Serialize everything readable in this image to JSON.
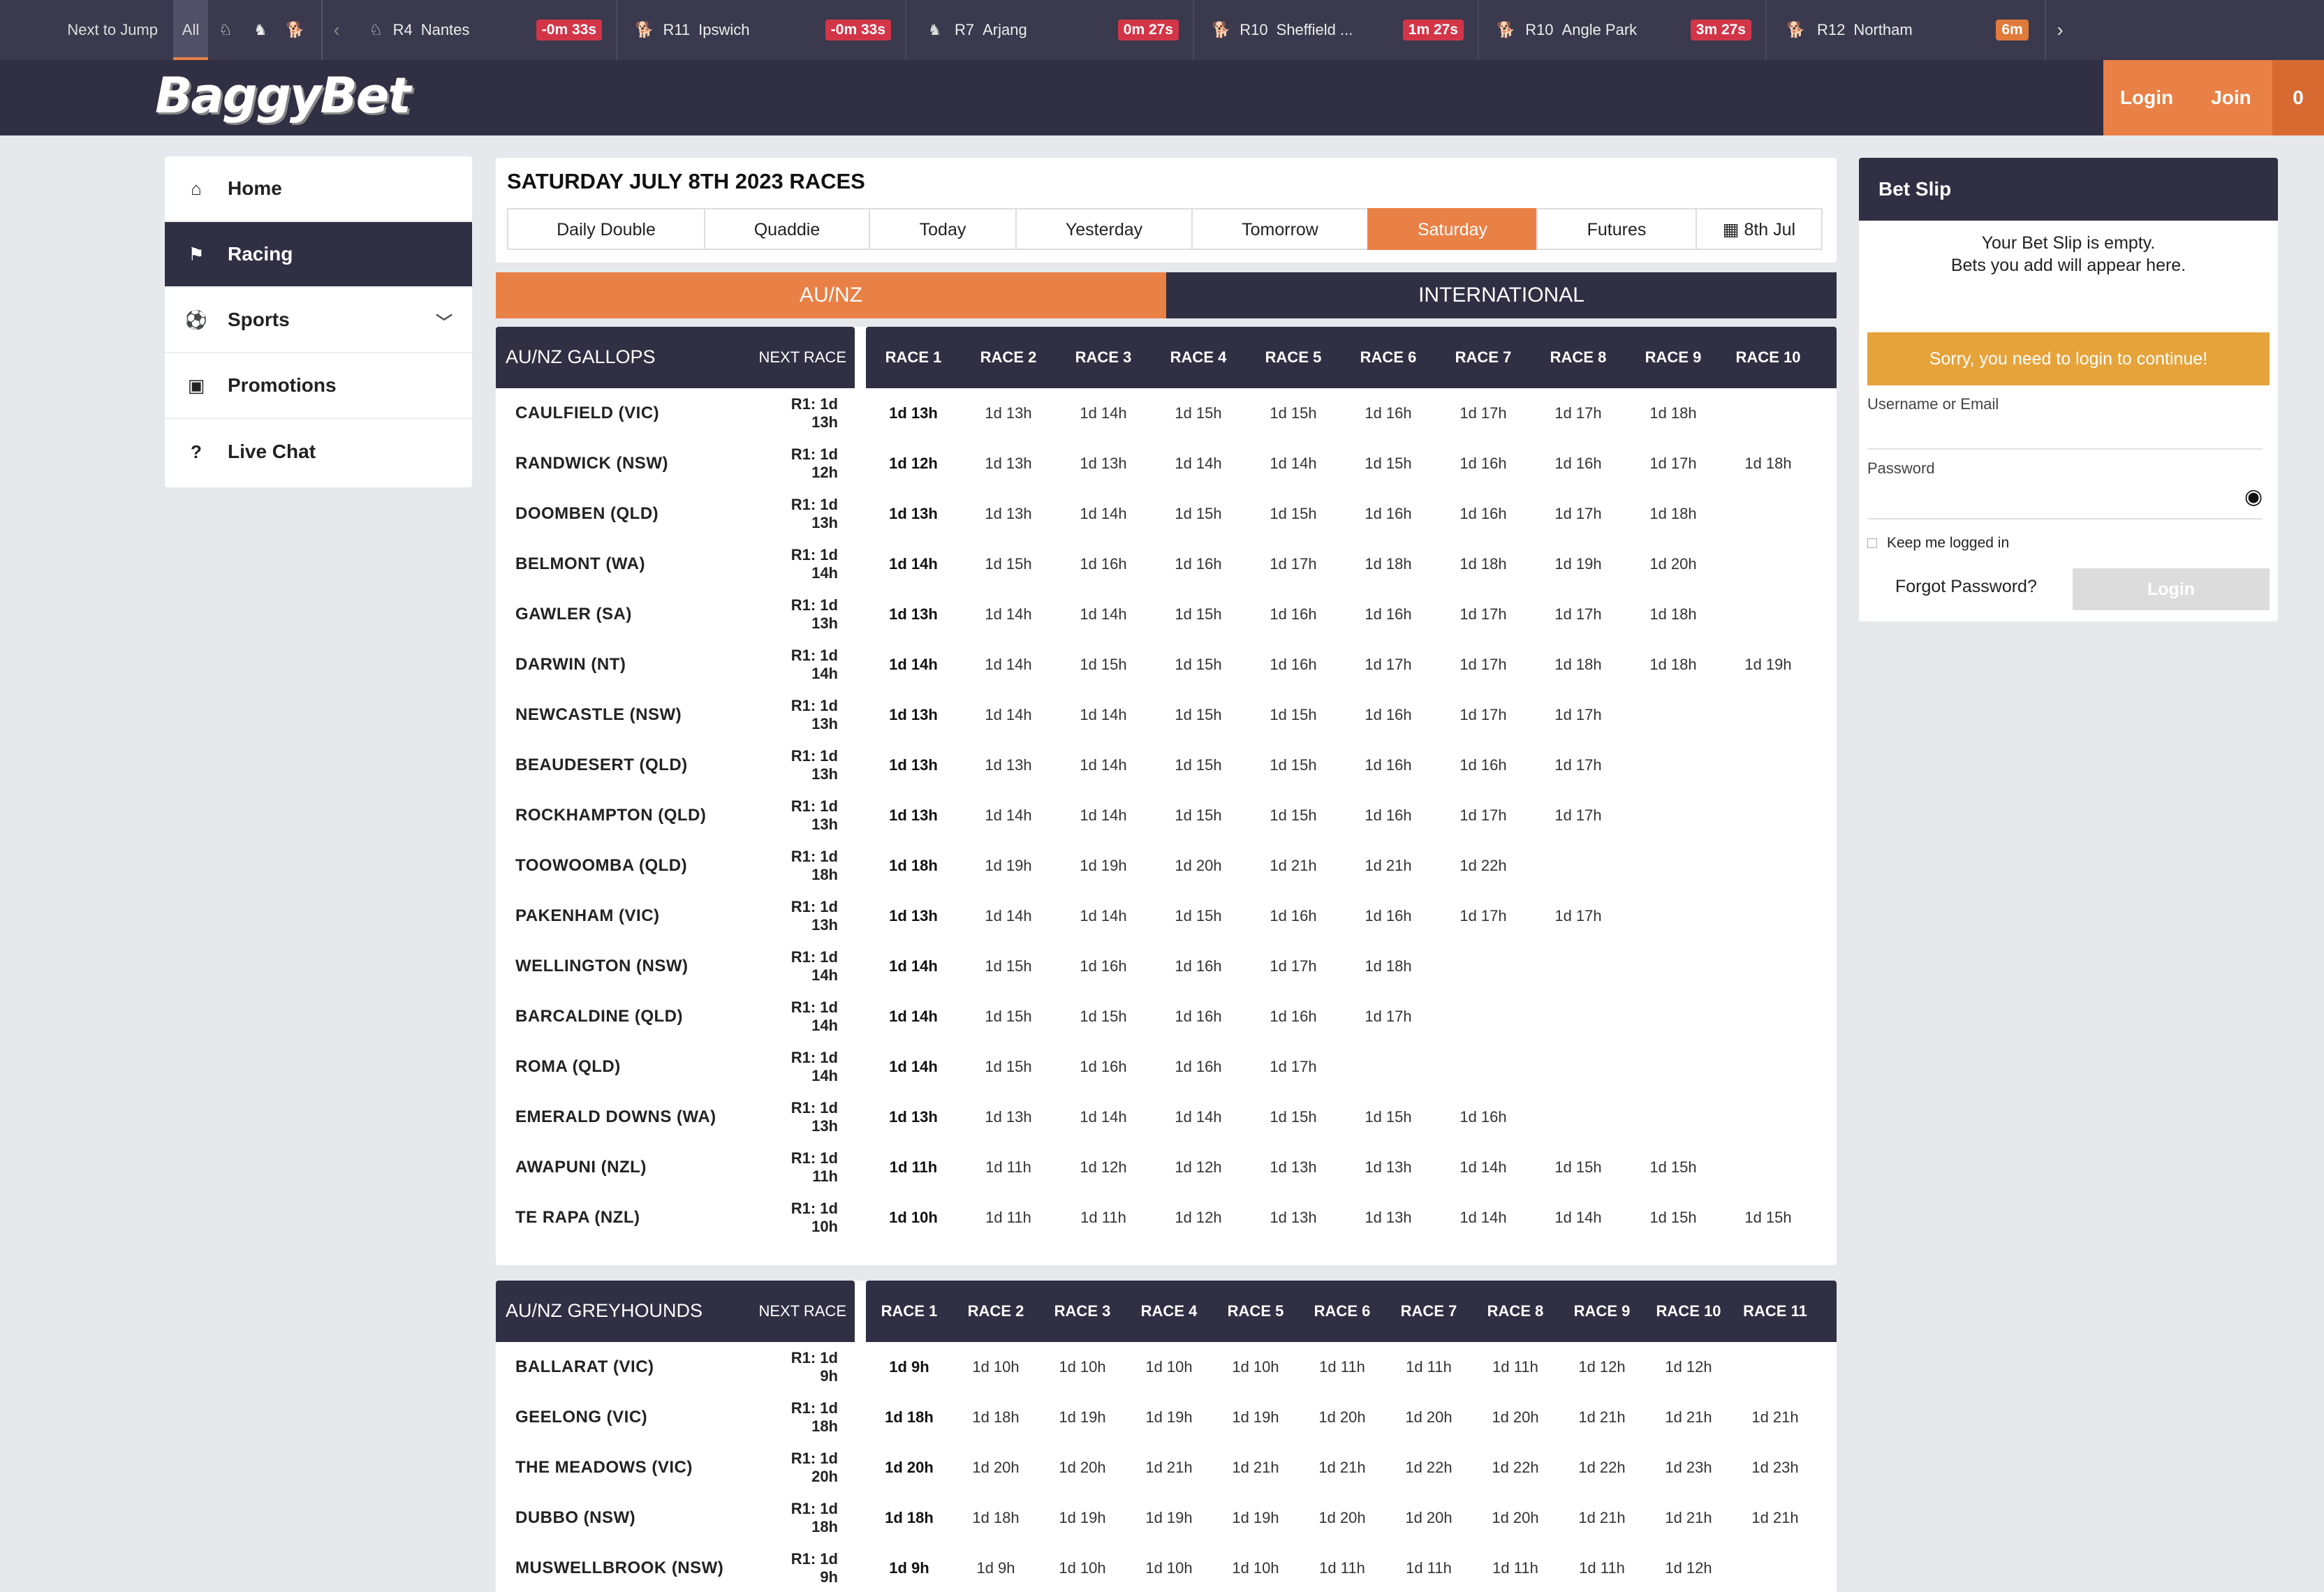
{
  "ticker": {
    "next_to_jump": "Next to Jump",
    "all": "All",
    "type_icons": [
      "horse-icon",
      "harness-icon",
      "greyhound-icon"
    ],
    "items": [
      {
        "race": "R4",
        "venue": "Nantes",
        "time": "-0m 33s",
        "icon": "horse-icon",
        "badge_color": "#d33548"
      },
      {
        "race": "R11",
        "venue": "Ipswich",
        "time": "-0m 33s",
        "icon": "greyhound-icon",
        "badge_color": "#d33548"
      },
      {
        "race": "R7",
        "venue": "Arjang",
        "time": "0m 27s",
        "icon": "harness-icon",
        "badge_color": "#d33548"
      },
      {
        "race": "R10",
        "venue": "Sheffield ...",
        "time": "1m 27s",
        "icon": "greyhound-icon",
        "badge_color": "#d33548"
      },
      {
        "race": "R10",
        "venue": "Angle Park",
        "time": "3m 27s",
        "icon": "greyhound-icon",
        "badge_color": "#d33548"
      },
      {
        "race": "R12",
        "venue": "Northam",
        "time": "6m",
        "icon": "greyhound-icon",
        "badge_color": "#e07a3a"
      }
    ]
  },
  "header": {
    "logo": "BaggyBet",
    "login": "Login",
    "join": "Join",
    "count": "0"
  },
  "sidebar": {
    "items": [
      {
        "label": "Home",
        "icon": "home-icon"
      },
      {
        "label": "Racing",
        "icon": "racing-icon"
      },
      {
        "label": "Sports",
        "icon": "soccer-ball-icon"
      },
      {
        "label": "Promotions",
        "icon": "gift-icon"
      },
      {
        "label": "Live Chat",
        "icon": "help-circle-icon"
      }
    ]
  },
  "main": {
    "title": "SATURDAY JULY 8TH 2023 RACES",
    "tabs": [
      "Daily Double",
      "Quaddie",
      "Today",
      "Yesterday",
      "Tomorrow",
      "Saturday",
      "Futures",
      "8th Jul"
    ],
    "regions": [
      "AU/NZ",
      "INTERNATIONAL"
    ],
    "gallops": {
      "title": "AU/NZ GALLOPS",
      "next_race": "NEXT RACE",
      "races": [
        "RACE 1",
        "RACE 2",
        "RACE 3",
        "RACE 4",
        "RACE 5",
        "RACE 6",
        "RACE 7",
        "RACE 8",
        "RACE 9",
        "RACE 10"
      ],
      "rows": [
        {
          "venue": "CAULFIELD (VIC)",
          "next": "R1: 1d 13h",
          "times": [
            "1d 13h",
            "1d 13h",
            "1d 14h",
            "1d 15h",
            "1d 15h",
            "1d 16h",
            "1d 17h",
            "1d 17h",
            "1d 18h",
            ""
          ]
        },
        {
          "venue": "RANDWICK (NSW)",
          "next": "R1: 1d 12h",
          "times": [
            "1d 12h",
            "1d 13h",
            "1d 13h",
            "1d 14h",
            "1d 14h",
            "1d 15h",
            "1d 16h",
            "1d 16h",
            "1d 17h",
            "1d 18h"
          ]
        },
        {
          "venue": "DOOMBEN (QLD)",
          "next": "R1: 1d 13h",
          "times": [
            "1d 13h",
            "1d 13h",
            "1d 14h",
            "1d 15h",
            "1d 15h",
            "1d 16h",
            "1d 16h",
            "1d 17h",
            "1d 18h",
            ""
          ]
        },
        {
          "venue": "BELMONT (WA)",
          "next": "R1: 1d 14h",
          "times": [
            "1d 14h",
            "1d 15h",
            "1d 16h",
            "1d 16h",
            "1d 17h",
            "1d 18h",
            "1d 18h",
            "1d 19h",
            "1d 20h",
            ""
          ]
        },
        {
          "venue": "GAWLER (SA)",
          "next": "R1: 1d 13h",
          "times": [
            "1d 13h",
            "1d 14h",
            "1d 14h",
            "1d 15h",
            "1d 16h",
            "1d 16h",
            "1d 17h",
            "1d 17h",
            "1d 18h",
            ""
          ]
        },
        {
          "venue": "DARWIN (NT)",
          "next": "R1: 1d 14h",
          "times": [
            "1d 14h",
            "1d 14h",
            "1d 15h",
            "1d 15h",
            "1d 16h",
            "1d 17h",
            "1d 17h",
            "1d 18h",
            "1d 18h",
            "1d 19h"
          ]
        },
        {
          "venue": "NEWCASTLE (NSW)",
          "next": "R1: 1d 13h",
          "times": [
            "1d 13h",
            "1d 14h",
            "1d 14h",
            "1d 15h",
            "1d 15h",
            "1d 16h",
            "1d 17h",
            "1d 17h",
            "",
            ""
          ]
        },
        {
          "venue": "BEAUDESERT (QLD)",
          "next": "R1: 1d 13h",
          "times": [
            "1d 13h",
            "1d 13h",
            "1d 14h",
            "1d 15h",
            "1d 15h",
            "1d 16h",
            "1d 16h",
            "1d 17h",
            "",
            ""
          ]
        },
        {
          "venue": "ROCKHAMPTON (QLD)",
          "next": "R1: 1d 13h",
          "times": [
            "1d 13h",
            "1d 14h",
            "1d 14h",
            "1d 15h",
            "1d 15h",
            "1d 16h",
            "1d 17h",
            "1d 17h",
            "",
            ""
          ]
        },
        {
          "venue": "TOOWOOMBA (QLD)",
          "next": "R1: 1d 18h",
          "times": [
            "1d 18h",
            "1d 19h",
            "1d 19h",
            "1d 20h",
            "1d 21h",
            "1d 21h",
            "1d 22h",
            "",
            "",
            ""
          ]
        },
        {
          "venue": "PAKENHAM (VIC)",
          "next": "R1: 1d 13h",
          "times": [
            "1d 13h",
            "1d 14h",
            "1d 14h",
            "1d 15h",
            "1d 16h",
            "1d 16h",
            "1d 17h",
            "1d 17h",
            "",
            ""
          ]
        },
        {
          "venue": "WELLINGTON (NSW)",
          "next": "R1: 1d 14h",
          "times": [
            "1d 14h",
            "1d 15h",
            "1d 16h",
            "1d 16h",
            "1d 17h",
            "1d 18h",
            "",
            "",
            "",
            ""
          ]
        },
        {
          "venue": "BARCALDINE (QLD)",
          "next": "R1: 1d 14h",
          "times": [
            "1d 14h",
            "1d 15h",
            "1d 15h",
            "1d 16h",
            "1d 16h",
            "1d 17h",
            "",
            "",
            "",
            ""
          ]
        },
        {
          "venue": "ROMA (QLD)",
          "next": "R1: 1d 14h",
          "times": [
            "1d 14h",
            "1d 15h",
            "1d 16h",
            "1d 16h",
            "1d 17h",
            "",
            "",
            "",
            "",
            ""
          ]
        },
        {
          "venue": "EMERALD DOWNS (WA)",
          "next": "R1: 1d 13h",
          "times": [
            "1d 13h",
            "1d 13h",
            "1d 14h",
            "1d 14h",
            "1d 15h",
            "1d 15h",
            "1d 16h",
            "",
            "",
            ""
          ]
        },
        {
          "venue": "AWAPUNI (NZL)",
          "next": "R1: 1d 11h",
          "times": [
            "1d 11h",
            "1d 11h",
            "1d 12h",
            "1d 12h",
            "1d 13h",
            "1d 13h",
            "1d 14h",
            "1d 15h",
            "1d 15h",
            ""
          ]
        },
        {
          "venue": "TE RAPA (NZL)",
          "next": "R1: 1d 10h",
          "times": [
            "1d 10h",
            "1d 11h",
            "1d 11h",
            "1d 12h",
            "1d 13h",
            "1d 13h",
            "1d 14h",
            "1d 14h",
            "1d 15h",
            "1d 15h"
          ]
        }
      ]
    },
    "greyhounds": {
      "title": "AU/NZ GREYHOUNDS",
      "next_race": "NEXT RACE",
      "races": [
        "RACE 1",
        "RACE 2",
        "RACE 3",
        "RACE 4",
        "RACE 5",
        "RACE 6",
        "RACE 7",
        "RACE 8",
        "RACE 9",
        "RACE 10",
        "RACE 11"
      ],
      "rows": [
        {
          "venue": "BALLARAT (VIC)",
          "next": "R1: 1d 9h",
          "times": [
            "1d 9h",
            "1d 10h",
            "1d 10h",
            "1d 10h",
            "1d 10h",
            "1d 11h",
            "1d 11h",
            "1d 11h",
            "1d 12h",
            "1d 12h",
            ""
          ]
        },
        {
          "venue": "GEELONG (VIC)",
          "next": "R1: 1d 18h",
          "times": [
            "1d 18h",
            "1d 18h",
            "1d 19h",
            "1d 19h",
            "1d 19h",
            "1d 20h",
            "1d 20h",
            "1d 20h",
            "1d 21h",
            "1d 21h",
            "1d 21h"
          ]
        },
        {
          "venue": "THE MEADOWS (VIC)",
          "next": "R1: 1d 20h",
          "times": [
            "1d 20h",
            "1d 20h",
            "1d 20h",
            "1d 21h",
            "1d 21h",
            "1d 21h",
            "1d 22h",
            "1d 22h",
            "1d 22h",
            "1d 23h",
            "1d 23h"
          ]
        },
        {
          "venue": "DUBBO (NSW)",
          "next": "R1: 1d 18h",
          "times": [
            "1d 18h",
            "1d 18h",
            "1d 19h",
            "1d 19h",
            "1d 19h",
            "1d 20h",
            "1d 20h",
            "1d 20h",
            "1d 21h",
            "1d 21h",
            "1d 21h"
          ]
        },
        {
          "venue": "MUSWELLBROOK (NSW)",
          "next": "R1: 1d 9h",
          "times": [
            "1d 9h",
            "1d 9h",
            "1d 10h",
            "1d 10h",
            "1d 10h",
            "1d 11h",
            "1d 11h",
            "1d 11h",
            "1d 11h",
            "1d 12h",
            ""
          ]
        }
      ]
    }
  },
  "betslip": {
    "title": "Bet Slip",
    "empty_line1": "Your Bet Slip is empty.",
    "empty_line2": "Bets you add will appear here.",
    "login_warning": "Sorry, you need to login to continue!",
    "username_label": "Username or Email",
    "password_label": "Password",
    "keep_logged": "Keep me logged in",
    "forgot": "Forgot Password?",
    "login": "Login"
  },
  "colors": {
    "accent": "#e98046",
    "dark": "#302f43",
    "alert": "#d33548",
    "warning": "#e6a33a"
  }
}
